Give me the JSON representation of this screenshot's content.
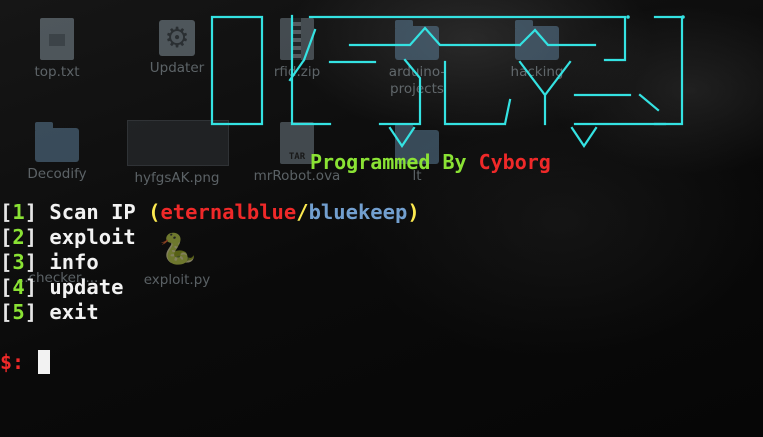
{
  "desktop_icons": [
    {
      "label": "top.txt",
      "icon": "text-file-icon"
    },
    {
      "label": "Updater",
      "icon": "gear-icon"
    },
    {
      "label": "rfid.zip",
      "icon": "zip-file-icon"
    },
    {
      "label": "arduino-projects",
      "icon": "folder-icon"
    },
    {
      "label": "hacking",
      "icon": "folder-icon"
    },
    {
      "label": "Decodify",
      "icon": "folder-icon"
    },
    {
      "label": "hyfgsAK.png",
      "icon": "image-file-icon"
    },
    {
      "label": "mrRobot.ova",
      "icon": "archive-file-icon"
    },
    {
      "label": "lt",
      "icon": "folder-icon"
    },
    {
      "label": "exploit.py",
      "icon": "python-file-icon"
    },
    {
      "label": "...checker-...",
      "icon": "folder-icon"
    }
  ],
  "credit": {
    "prefix": "Programmed By ",
    "author": "Cyborg"
  },
  "menu": [
    {
      "num": "1",
      "label": "Scan IP ",
      "open": "(",
      "opt1": "eternalblue",
      "sep": "/",
      "opt2": "bluekeep",
      "close": ")"
    },
    {
      "num": "2",
      "label": "exploit"
    },
    {
      "num": "3",
      "label": "info"
    },
    {
      "num": "4",
      "label": "update"
    },
    {
      "num": "5",
      "label": "exit"
    }
  ],
  "prompt": "$:",
  "colors": {
    "banner_cyan": "#34e2e2",
    "green": "#8ae234",
    "red": "#ef2929",
    "yellow": "#fce94f",
    "blue": "#729fcf"
  }
}
